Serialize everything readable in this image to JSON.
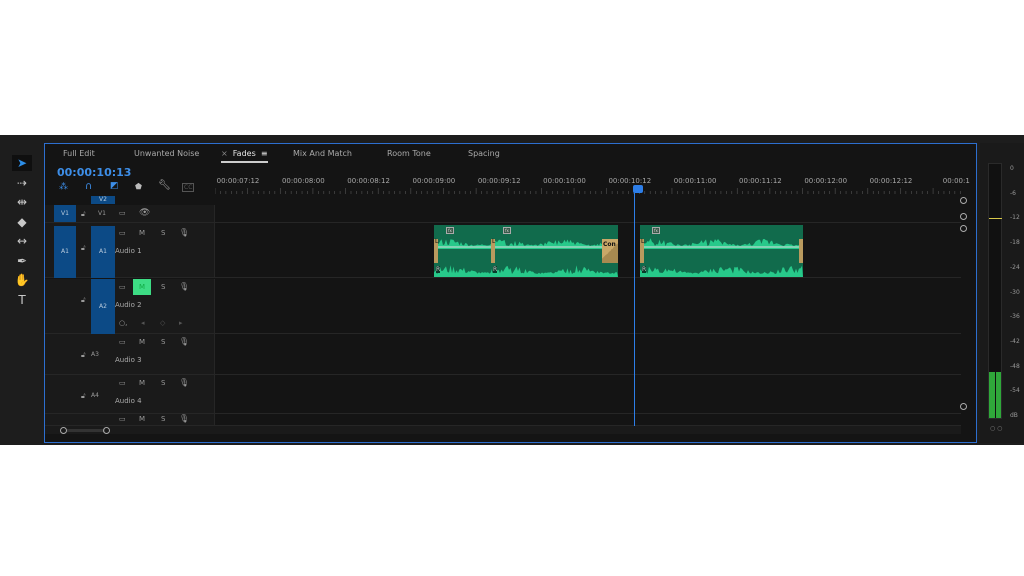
{
  "tools": [
    {
      "name": "selection-tool",
      "glyph": "➤"
    },
    {
      "name": "track-select-tool",
      "glyph": "⇢"
    },
    {
      "name": "ripple-edit-tool",
      "glyph": "⇹"
    },
    {
      "name": "razor-tool",
      "glyph": "◆"
    },
    {
      "name": "slip-tool",
      "glyph": "↔"
    },
    {
      "name": "pen-tool",
      "glyph": "✒"
    },
    {
      "name": "hand-tool",
      "glyph": "✋"
    },
    {
      "name": "type-tool",
      "glyph": "T"
    }
  ],
  "tabs": [
    {
      "label": "Full Edit"
    },
    {
      "label": "Unwanted Noise"
    },
    {
      "label": "Fades",
      "active": true
    },
    {
      "label": "Mix And Match"
    },
    {
      "label": "Room Tone"
    },
    {
      "label": "Spacing"
    }
  ],
  "timecode": "00:00:10:13",
  "ruler": [
    "00:00:07:12",
    "00:00:08:00",
    "00:00:08:12",
    "00:00:09:00",
    "00:00:09:12",
    "00:00:10:00",
    "00:00:10:12",
    "00:00:11:00",
    "00:00:11:12",
    "00:00:12:00",
    "00:00:12:12",
    "00:00:1"
  ],
  "tracks": {
    "v2": "V2",
    "v1": {
      "src": "V1",
      "id": "V1"
    },
    "audio": [
      {
        "src": "A1",
        "id": "A1",
        "name": "Audio 1"
      },
      {
        "src": "",
        "id": "A2",
        "name": "Audio 2",
        "muted": true
      },
      {
        "src": "",
        "id": "A3",
        "name": "Audio 3"
      },
      {
        "src": "",
        "id": "A4",
        "name": "Audio 4"
      }
    ],
    "m": "M",
    "s": "S"
  },
  "clips": {
    "fx": "fx",
    "left": "L",
    "right": "R",
    "transition": "Con"
  },
  "meter": {
    "labels": [
      "0",
      "-6",
      "-12",
      "-18",
      "-24",
      "-30",
      "-36",
      "-42",
      "-48",
      "-54",
      "dB"
    ],
    "level_db": -48,
    "peak_db": -12,
    "color": "#2fa83a"
  },
  "colors": {
    "accent": "#2d6fd0",
    "clip": "#116b4c",
    "waveform": "#27c98a",
    "mute": "#3ddc84"
  }
}
